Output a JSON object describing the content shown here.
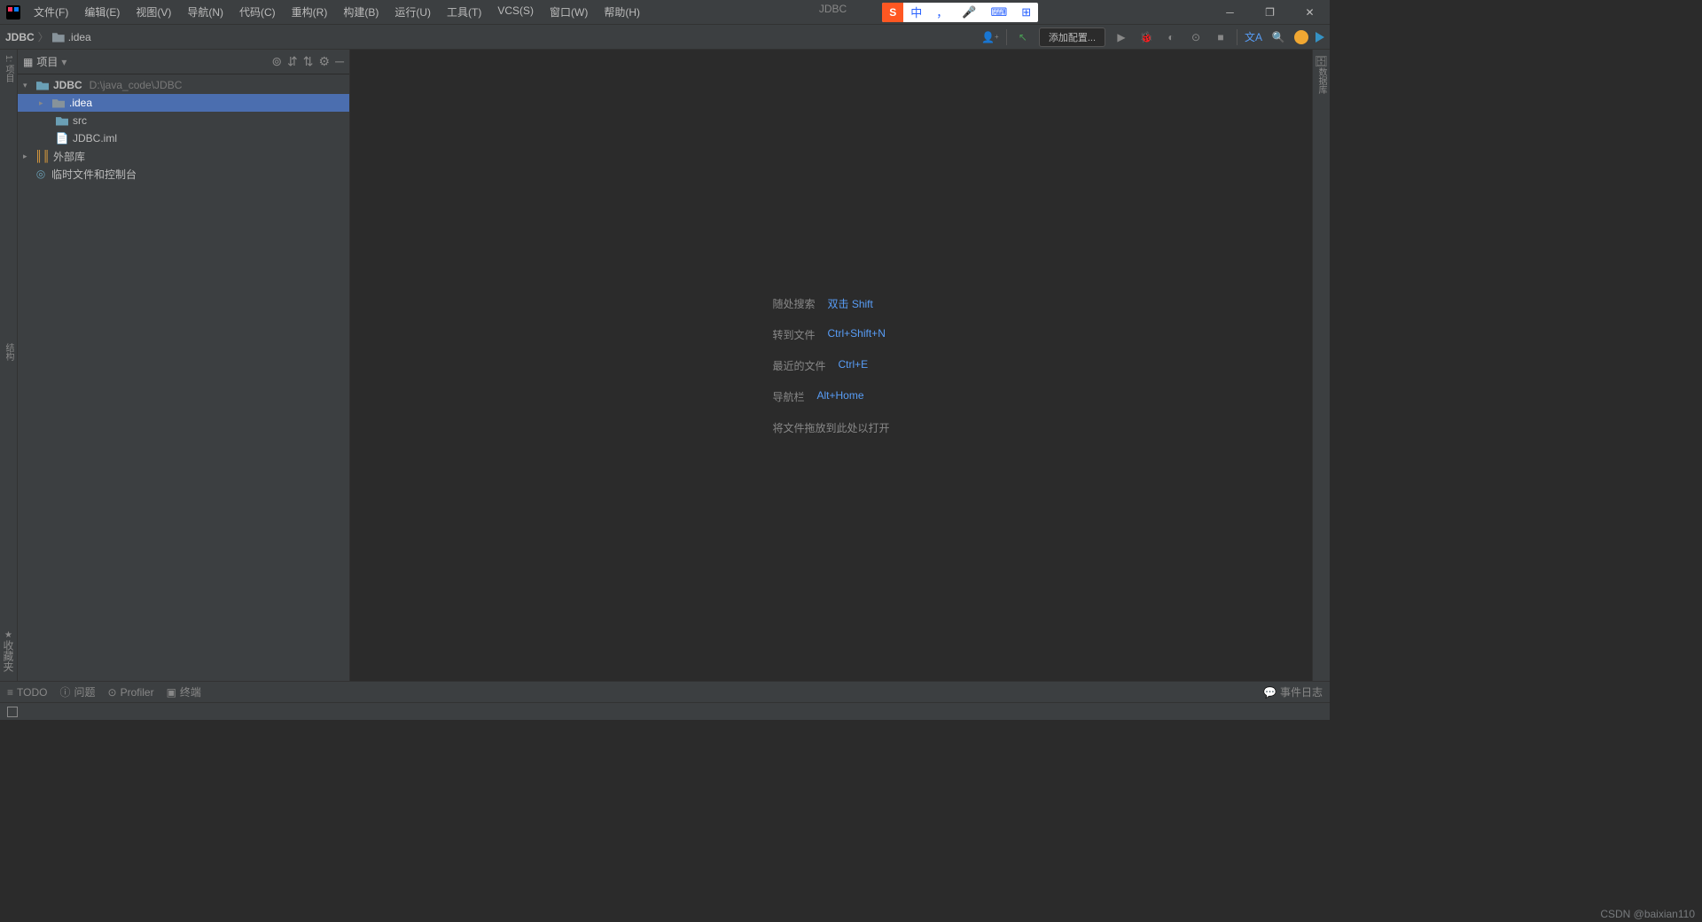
{
  "menu": {
    "file": "文件(F)",
    "edit": "编辑(E)",
    "view": "视图(V)",
    "nav": "导航(N)",
    "code": "代码(C)",
    "refactor": "重构(R)",
    "build": "构建(B)",
    "run": "运行(U)",
    "tools": "工具(T)",
    "vcs": "VCS(S)",
    "window": "窗口(W)",
    "help": "帮助(H)"
  },
  "title": "JDBC",
  "ime": {
    "lang": "中",
    "punct": "，",
    "voice": "🎤",
    "kbd": "⌨",
    "grid": "▦"
  },
  "breadcrumb": {
    "root": "JDBC",
    "child": ".idea"
  },
  "runConfig": "添加配置...",
  "sidebar": {
    "title": "项目",
    "tree": {
      "root": "JDBC",
      "rootPath": "D:\\java_code\\JDBC",
      "idea": ".idea",
      "src": "src",
      "iml": "JDBC.iml",
      "extlib": "外部库",
      "scratch": "临时文件和控制台"
    }
  },
  "leftGutter": {
    "proj": "1: 项目",
    "struct": "结构",
    "fav": "收藏夹"
  },
  "rightGutter": {
    "db": "数据库"
  },
  "welcome": {
    "r1l": "随处搜索",
    "r1k": "双击 Shift",
    "r2l": "转到文件",
    "r2k": "Ctrl+Shift+N",
    "r3l": "最近的文件",
    "r3k": "Ctrl+E",
    "r4l": "导航栏",
    "r4k": "Alt+Home",
    "r5l": "将文件拖放到此处以打开"
  },
  "status": {
    "todo": "TODO",
    "problems": "问题",
    "profiler": "Profiler",
    "terminal": "终端",
    "eventlog": "事件日志"
  },
  "watermark": "CSDN @baixian110"
}
